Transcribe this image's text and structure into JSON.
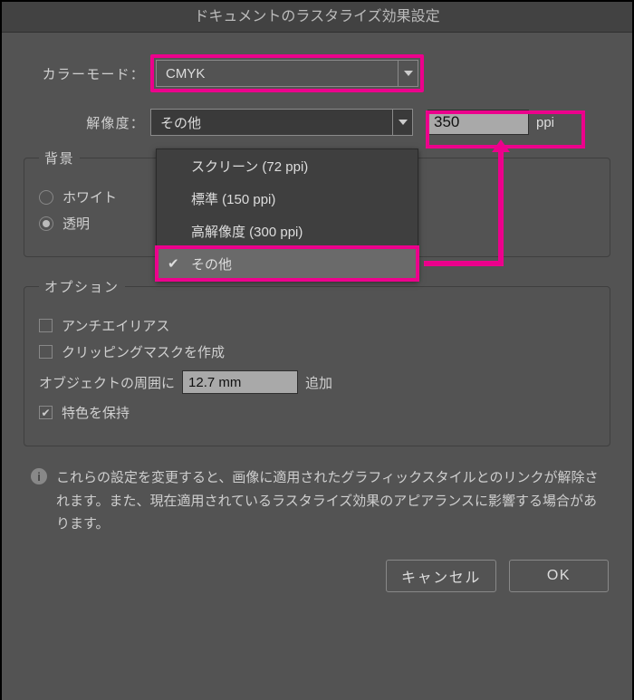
{
  "title": "ドキュメントのラスタライズ効果設定",
  "color_mode": {
    "label": "カラーモード：",
    "value": "CMYK"
  },
  "resolution": {
    "label": "解像度：",
    "value": "その他",
    "options": [
      {
        "label": "スクリーン (72 ppi)",
        "selected": false
      },
      {
        "label": "標準 (150 ppi)",
        "selected": false
      },
      {
        "label": "高解像度 (300 ppi)",
        "selected": false
      },
      {
        "label": "その他",
        "selected": true
      }
    ],
    "custom_value": "350",
    "unit": "ppi"
  },
  "background": {
    "legend": "背景",
    "white": {
      "label": "ホワイト",
      "checked": false
    },
    "transparent": {
      "label": "透明",
      "checked": true
    }
  },
  "options": {
    "legend": "オプション",
    "antialias": {
      "label": "アンチエイリアス",
      "checked": false
    },
    "clipmask": {
      "label": "クリッピングマスクを作成",
      "checked": false
    },
    "around_prefix": "オブジェクトの周囲に",
    "around_value": "12.7 mm",
    "around_suffix": "追加",
    "spotcolor": {
      "label": "特色を保持",
      "checked": true
    }
  },
  "info": "これらの設定を変更すると、画像に適用されたグラフィックスタイルとのリンクが解除されます。また、現在適用されているラスタライズ効果のアピアランスに影響する場合があります。",
  "buttons": {
    "cancel": "キャンセル",
    "ok": "OK"
  }
}
